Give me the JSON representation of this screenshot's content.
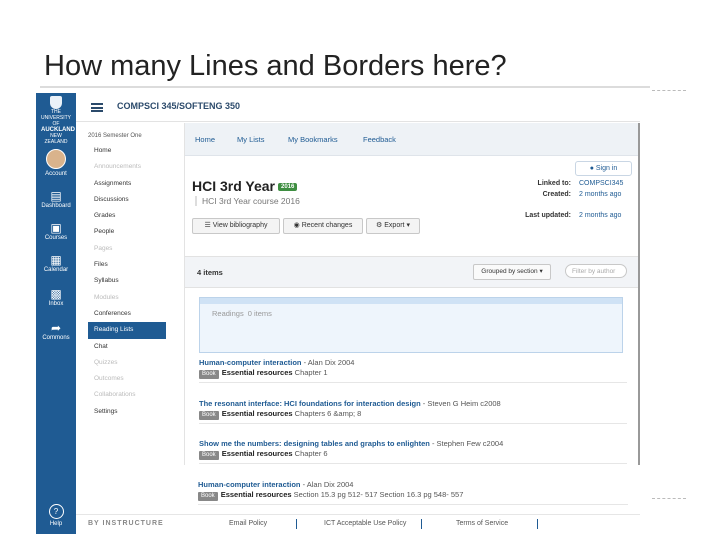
{
  "slide": {
    "title": "How many Lines and Borders here?"
  },
  "global_nav": {
    "logo_lines": [
      "THE UNIVERSITY OF",
      "AUCKLAND",
      "NEW ZEALAND"
    ],
    "items": [
      {
        "label": "Account",
        "icon": "avatar"
      },
      {
        "label": "Dashboard",
        "icon": "dashboard-icon"
      },
      {
        "label": "Courses",
        "icon": "courses-icon"
      },
      {
        "label": "Calendar",
        "icon": "calendar-icon"
      },
      {
        "label": "Inbox",
        "icon": "inbox-icon"
      },
      {
        "label": "Commons",
        "icon": "commons-icon"
      }
    ],
    "help_label": "Help"
  },
  "header": {
    "breadcrumb": "COMPSCI 345/SOFTENG 350"
  },
  "course_nav": {
    "term": "2016 Semester One",
    "items": [
      {
        "label": "Home",
        "state": "normal"
      },
      {
        "label": "Announcements",
        "state": "dim"
      },
      {
        "label": "Assignments",
        "state": "normal"
      },
      {
        "label": "Discussions",
        "state": "normal"
      },
      {
        "label": "Grades",
        "state": "normal"
      },
      {
        "label": "People",
        "state": "normal"
      },
      {
        "label": "Pages",
        "state": "dim"
      },
      {
        "label": "Files",
        "state": "normal"
      },
      {
        "label": "Syllabus",
        "state": "normal"
      },
      {
        "label": "Modules",
        "state": "dim"
      },
      {
        "label": "Conferences",
        "state": "normal"
      },
      {
        "label": "Reading Lists",
        "state": "active"
      },
      {
        "label": "Chat",
        "state": "normal"
      },
      {
        "label": "Quizzes",
        "state": "dim"
      },
      {
        "label": "Outcomes",
        "state": "dim"
      },
      {
        "label": "Collaborations",
        "state": "dim"
      },
      {
        "label": "Settings",
        "state": "normal"
      }
    ]
  },
  "tabs": [
    "Home",
    "My Lists",
    "My Bookmarks",
    "Feedback"
  ],
  "sign_in": "Sign in",
  "list": {
    "title": "HCI 3rd Year",
    "badge": "2016",
    "subtitle": "HCI 3rd Year course 2016",
    "meta": [
      {
        "key": "Linked to:",
        "value": "COMPSCI345"
      },
      {
        "key": "Created:",
        "value": "2 months ago"
      },
      {
        "key": "Last updated:",
        "value": "2 months ago"
      }
    ]
  },
  "toolbar": {
    "view_bibliography": "View bibliography",
    "recent_changes": "Recent changes",
    "export": "Export"
  },
  "summary": {
    "count": "4 items",
    "grouped": "Grouped by section",
    "filter_placeholder": "Filter by author"
  },
  "section": {
    "name": "Readings",
    "count": "0 items"
  },
  "items": [
    {
      "title": "Human-computer interaction",
      "author": " - Alan Dix 2004",
      "type": "Book",
      "category": "Essential resources",
      "detail": "Chapter 1"
    },
    {
      "title": "The resonant interface: HCI foundations for interaction design",
      "author": " - Steven G Heim c2008",
      "type": "Book",
      "category": "Essential resources",
      "detail": "Chapters 6 &amp; 8"
    },
    {
      "title": "Show me the numbers: designing tables and graphs to enlighten",
      "author": " - Stephen Few c2004",
      "type": "Book",
      "category": "Essential resources",
      "detail": "Chapter 6"
    },
    {
      "title": "Human-computer interaction",
      "author": " - Alan Dix 2004",
      "type": "Book",
      "category": "Essential resources",
      "detail": "Section 15.3 pg 512- 517 Section 16.3 pg 548- 557"
    }
  ],
  "footer": {
    "brand": "BY INSTRUCTURE",
    "links": [
      "Email Policy",
      "ICT Acceptable Use Policy",
      "Terms of Service"
    ]
  },
  "colors": {
    "brand_blue": "#1f5b93",
    "badge_green": "#3e8e41"
  }
}
